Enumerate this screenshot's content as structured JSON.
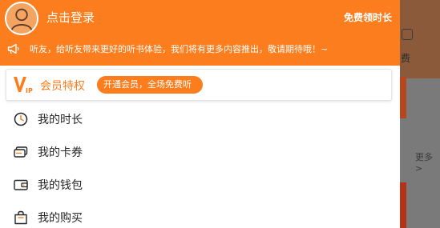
{
  "background": {
    "fee_text": "费",
    "more_text": "更多 >"
  },
  "header": {
    "login_text": "点击登录",
    "free_listen": "免费领时长",
    "notice_text": "听友，给听友带来更好的听书体验，我们将有更多内容推出，敬请期待哦！~"
  },
  "vip": {
    "logo_text": "VIP",
    "label": "会员特权",
    "badge": "开通会员，全场免费听"
  },
  "menu": {
    "items": [
      {
        "label": "我的时长",
        "icon": "clock-icon"
      },
      {
        "label": "我的卡券",
        "icon": "card-icon"
      },
      {
        "label": "我的钱包",
        "icon": "wallet-icon"
      },
      {
        "label": "我的购买",
        "icon": "shopping-bag-icon"
      }
    ]
  },
  "colors": {
    "accent": "#fb7d1d",
    "text": "#262626",
    "overlay": "#7a7a7a"
  }
}
